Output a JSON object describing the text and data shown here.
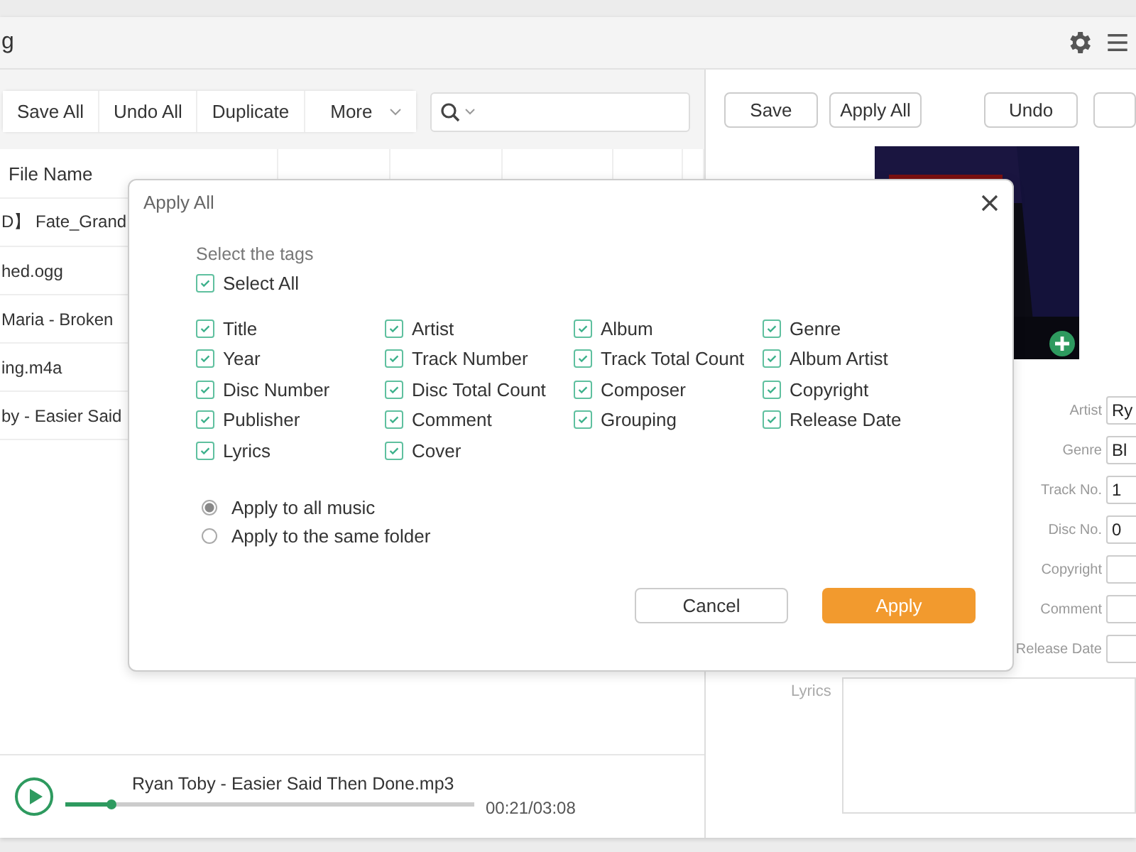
{
  "window": {
    "title": "g"
  },
  "toolbar": {
    "buttons": [
      "Save All",
      "Undo All",
      "Duplicate"
    ],
    "more": "More"
  },
  "table": {
    "columns": [
      "File Name"
    ],
    "rows": [
      {
        "file_name": "D】 Fate_Grand"
      },
      {
        "file_name": "hed.ogg"
      },
      {
        "file_name": "Maria - Broken"
      },
      {
        "file_name": "ing.m4a"
      },
      {
        "file_name": "by - Easier Said"
      }
    ]
  },
  "editor": {
    "buttons": [
      "Save",
      "Apply All",
      "Undo"
    ],
    "fields": [
      {
        "label": "Artist",
        "value": "Ry"
      },
      {
        "label": "Genre",
        "value": "Bl"
      },
      {
        "label": "Track No.",
        "value": "1"
      },
      {
        "label": "Disc No.",
        "value": "0"
      },
      {
        "label": "Copyright"
      },
      {
        "label": "Comment"
      },
      {
        "label": "Release Date"
      }
    ],
    "lyrics_label": "Lyrics"
  },
  "dialog": {
    "title": "Apply All",
    "section": "Select the tags",
    "select_all": {
      "label": "Select All",
      "checked": true
    },
    "tags": [
      {
        "label": "Title",
        "checked": true
      },
      {
        "label": "Artist",
        "checked": true
      },
      {
        "label": "Album",
        "checked": true
      },
      {
        "label": "Genre",
        "checked": true
      },
      {
        "label": "Year",
        "checked": true
      },
      {
        "label": "Track Number",
        "checked": true
      },
      {
        "label": "Track Total Count",
        "checked": true
      },
      {
        "label": "Album Artist",
        "checked": true
      },
      {
        "label": "Disc Number",
        "checked": true
      },
      {
        "label": "Disc Total Count",
        "checked": true
      },
      {
        "label": "Composer",
        "checked": true
      },
      {
        "label": "Copyright",
        "checked": true
      },
      {
        "label": "Publisher",
        "checked": true
      },
      {
        "label": "Comment",
        "checked": true
      },
      {
        "label": "Grouping",
        "checked": true
      },
      {
        "label": "Release Date",
        "checked": true
      },
      {
        "label": "Lyrics",
        "checked": true
      },
      {
        "label": "Cover",
        "checked": true
      }
    ],
    "scope": [
      {
        "label": "Apply to all music",
        "selected": true
      },
      {
        "label": "Apply to the same folder",
        "selected": false
      }
    ],
    "cancel": "Cancel",
    "apply": "Apply"
  },
  "player": {
    "track": "Ryan Toby - Easier Said Then Done.mp3",
    "level": 0.11,
    "time": "00:21/03:08"
  }
}
